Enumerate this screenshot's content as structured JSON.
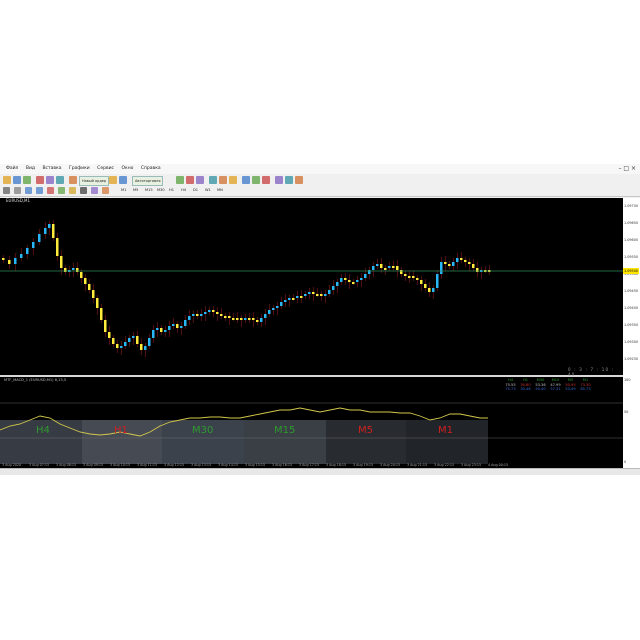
{
  "menubar": {
    "items": [
      "Файл",
      "Вид",
      "Вставка",
      "Графики",
      "Сервис",
      "Окно",
      "Справка"
    ]
  },
  "toolbar": {
    "new_order_label": "Новый ордер",
    "autotrade_label": "Автоторговля",
    "icons": [
      "new-chart-icon",
      "profiles-icon",
      "market-watch-icon",
      "navigator-icon",
      "terminal-icon",
      "tester-icon",
      "strategy-icon",
      "new-order-icon",
      "meta-editor-icon",
      "autotrade-icon",
      "bar-chart-icon",
      "candle-chart-icon",
      "line-chart-icon",
      "zoom-in-icon",
      "zoom-out-icon",
      "tile-icon",
      "scroll-icon",
      "shift-icon",
      "indicators-icon",
      "period-icon",
      "templates-icon"
    ]
  },
  "toolbar2": {
    "icons": [
      "cursor-icon",
      "crosshair-icon",
      "vertical-line-icon",
      "horizontal-line-icon",
      "trendline-icon",
      "equidistant-channel-icon",
      "fibonacci-icon",
      "text-icon",
      "label-icon",
      "arrows-icon"
    ],
    "periods": [
      "M1",
      "M5",
      "M15",
      "M30",
      "H1",
      "H4",
      "D1",
      "W1",
      "MN"
    ]
  },
  "window_controls": [
    "–",
    "□",
    "×"
  ],
  "chart": {
    "symbol_title": "EURUSD,M1",
    "subwindow_title": "MTF_MACD_1 (EURUSD,M1) 6,13,5",
    "clock": "0 : 3 : 7 : 10 : 40",
    "current_price": "1.09500",
    "price_ticks": [
      "1.09700",
      "1.09650",
      "1.09600",
      "1.09550",
      "1.09500",
      "1.09450",
      "1.09400",
      "1.09350",
      "1.09300",
      "1.09250"
    ],
    "time_ticks": [
      "3 Aug 2020",
      "3 Aug 07:15",
      "3 Aug 08:15",
      "3 Aug 09:15",
      "3 Aug 10:15",
      "3 Aug 11:15",
      "3 Aug 12:15",
      "3 Aug 13:15",
      "3 Aug 14:15",
      "3 Aug 15:15",
      "3 Aug 16:15",
      "3 Aug 17:15",
      "3 Aug 18:15",
      "3 Aug 19:15",
      "3 Aug 20:15",
      "3 Aug 21:15",
      "3 Aug 22:15",
      "3 Aug 23:15",
      "4 Aug 00:15"
    ],
    "sub_levels": [
      "100",
      "50",
      "0"
    ],
    "timeframes": [
      {
        "name": "H4",
        "color": "#2e9a2e"
      },
      {
        "name": "H1",
        "color": "#d02020"
      },
      {
        "name": "M30",
        "color": "#2e9a2e"
      },
      {
        "name": "M15",
        "color": "#2e9a2e"
      },
      {
        "name": "M5",
        "color": "#d02020"
      },
      {
        "name": "M1",
        "color": "#d02020"
      }
    ],
    "mtf_table": {
      "header": [
        "H4",
        "H1",
        "M30",
        "M15",
        "M5",
        "M1"
      ],
      "row1": [
        "75.55",
        "30.80",
        "53.36",
        "47.99",
        "50.95",
        "73.30"
      ],
      "row2": [
        "75.73",
        "30.46",
        "50.40",
        "57.31",
        "53.49",
        "65.73"
      ]
    },
    "colors": {
      "bull": "#29b6f6",
      "bear": "#ffeb3b",
      "hline": "#2e8b57",
      "signal": "#d4c84a",
      "bg": "#000000"
    }
  }
}
